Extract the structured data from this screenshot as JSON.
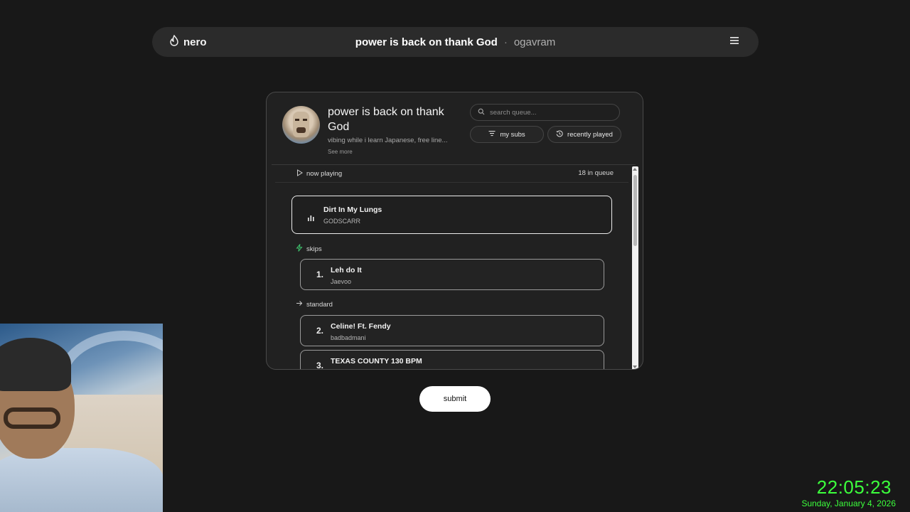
{
  "navbar": {
    "brand": "nero",
    "title": "power is back on thank God",
    "separator": "·",
    "username": "ogavram"
  },
  "playlist": {
    "title": "power is back on thank God",
    "description": "vibing while i learn Japanese, free line...",
    "see_more": "See more",
    "search_placeholder": "search queue...",
    "my_subs_label": "my subs",
    "recently_played_label": "recently played"
  },
  "queue": {
    "now_playing_label": "now playing",
    "count_label": "18 in queue",
    "now_playing": {
      "title": "Dirt In My Lungs",
      "artist": "GODSCARR"
    },
    "skips_label": "skips",
    "skips": [
      {
        "number": "1.",
        "title": "Leh do It",
        "artist": "Jaevoo"
      }
    ],
    "standard_label": "standard",
    "standard": [
      {
        "number": "2.",
        "title": "Celine! Ft. Fendy",
        "artist": "badbadmani"
      },
      {
        "number": "3.",
        "title": "TEXAS COUNTY 130 BPM",
        "artist": ""
      }
    ]
  },
  "submit_label": "submit",
  "clock": {
    "time": "22:05:23",
    "date": "Sunday, January 4, 2026"
  },
  "colors": {
    "background": "#181818",
    "accent_green": "#3cff3c",
    "skips_icon": "#3ec46d"
  },
  "icons": {
    "brand": "flame-icon",
    "menu": "hamburger-menu-icon",
    "search": "search-icon",
    "my_subs": "filter-icon",
    "recently_played": "history-icon",
    "now_playing": "play-icon",
    "equalizer": "equalizer-icon",
    "skips": "lightning-icon",
    "standard": "arrow-right-icon"
  }
}
